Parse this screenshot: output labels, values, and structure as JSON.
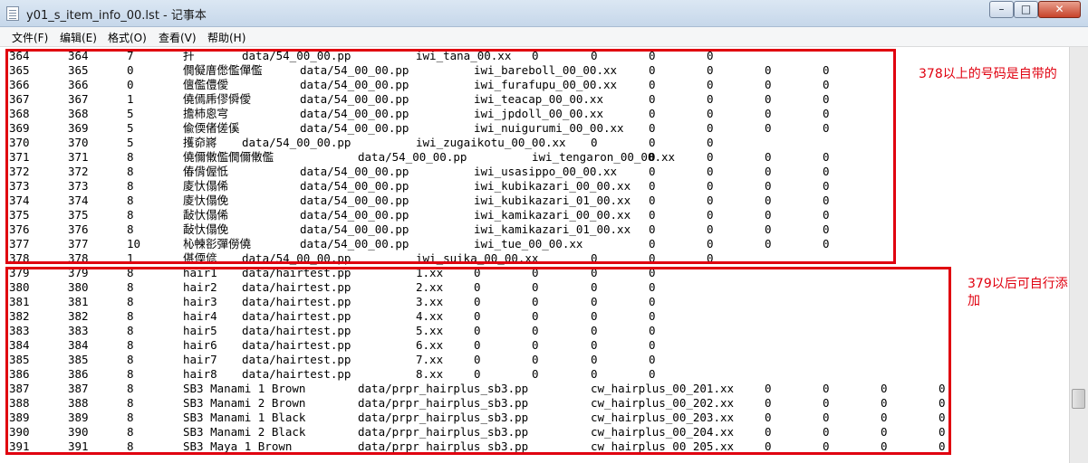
{
  "window": {
    "title": "y01_s_item_info_00.lst - 记事本",
    "minimize_glyph": "–",
    "maximize_glyph": "□",
    "close_glyph": "✕"
  },
  "menu": [
    "文件(F)",
    "编辑(E)",
    "格式(O)",
    "查看(V)",
    "帮助(H)"
  ],
  "lines": [
    [
      "364",
      "364",
      "7",
      "扞",
      "data/54_00_00.pp",
      "iwi_tana_00.xx",
      "0",
      "0",
      "0",
      "0"
    ],
    [
      "365",
      "365",
      "0",
      "僩儗庴僽儖僤儖",
      "data/54_00_00.pp",
      "iwi_bareboll_00_00.xx",
      "0",
      "0",
      "0",
      "0"
    ],
    [
      "366",
      "366",
      "0",
      "儃儖僼僾",
      "data/54_00_00.pp",
      "iwi_furafupu_00_00.xx",
      "0",
      "0",
      "0",
      "0"
    ],
    [
      "367",
      "367",
      "1",
      "僥傿乕僇僢僾",
      "data/54_00_00.pp",
      "iwi_teacap_00_00.xx",
      "0",
      "0",
      "0",
      "0"
    ],
    [
      "368",
      "368",
      "5",
      "擔杮恖宆",
      "data/54_00_00.pp",
      "iwi_jpdoll_00_00.xx",
      "0",
      "0",
      "0",
      "0"
    ],
    [
      "369",
      "369",
      "5",
      "偸偄偖傞傒",
      "data/54_00_00.pp",
      "iwi_nuigurumi_00_00.xx",
      "0",
      "0",
      "0",
      "0"
    ],
    [
      "370",
      "370",
      "5",
      "擭奅嶈",
      "data/54_00_00.pp",
      "iwi_zugaikotu_00_00.xx",
      "0",
      "0",
      "0"
    ],
    [
      "371",
      "371",
      "8",
      "僥儞僌儖僩儞僌儖",
      "data/54_00_00.pp",
      "iwi_tengaron_00_00.xx",
      "0",
      "0",
      "0",
      "0"
    ],
    [
      "372",
      "372",
      "8",
      "偆偝偓怟",
      "data/54_00_00.pp",
      "iwi_usasippo_00_00.xx",
      "0",
      "0",
      "0",
      "0"
    ],
    [
      "373",
      "373",
      "8",
      "庱忕傝俙",
      "data/54_00_00.pp",
      "iwi_kubikazari_00_00.xx",
      "0",
      "0",
      "0",
      "0"
    ],
    [
      "374",
      "374",
      "8",
      "庱忕傝俛",
      "data/54_00_00.pp",
      "iwi_kubikazari_01_00.xx",
      "0",
      "0",
      "0",
      "0"
    ],
    [
      "375",
      "375",
      "8",
      "敮忕傝俙",
      "data/54_00_00.pp",
      "iwi_kamikazari_00_00.xx",
      "0",
      "0",
      "0",
      "0"
    ],
    [
      "376",
      "376",
      "8",
      "敮忕傝俛",
      "data/54_00_00.pp",
      "iwi_kamikazari_01_00.xx",
      "0",
      "0",
      "0",
      "0"
    ],
    [
      "377",
      "377",
      "10",
      "杺朄彮彈僗僥",
      "data/54_00_00.pp",
      "iwi_tue_00_00.xx",
      "0",
      "0",
      "0",
      "0"
    ],
    [
      "378",
      "378",
      "1",
      "偡偄偐",
      "data/54_00_00.pp",
      "iwi_suika_00_00.xx",
      "0",
      "0",
      "0"
    ],
    [
      "379",
      "379",
      "8",
      "hair1",
      "data/hairtest.pp",
      "1.xx",
      "0",
      "0",
      "0",
      "0"
    ],
    [
      "380",
      "380",
      "8",
      "hair2",
      "data/hairtest.pp",
      "2.xx",
      "0",
      "0",
      "0",
      "0"
    ],
    [
      "381",
      "381",
      "8",
      "hair3",
      "data/hairtest.pp",
      "3.xx",
      "0",
      "0",
      "0",
      "0"
    ],
    [
      "382",
      "382",
      "8",
      "hair4",
      "data/hairtest.pp",
      "4.xx",
      "0",
      "0",
      "0",
      "0"
    ],
    [
      "383",
      "383",
      "8",
      "hair5",
      "data/hairtest.pp",
      "5.xx",
      "0",
      "0",
      "0",
      "0"
    ],
    [
      "384",
      "384",
      "8",
      "hair6",
      "data/hairtest.pp",
      "6.xx",
      "0",
      "0",
      "0",
      "0"
    ],
    [
      "385",
      "385",
      "8",
      "hair7",
      "data/hairtest.pp",
      "7.xx",
      "0",
      "0",
      "0",
      "0"
    ],
    [
      "386",
      "386",
      "8",
      "hair8",
      "data/hairtest.pp",
      "8.xx",
      "0",
      "0",
      "0",
      "0"
    ],
    [
      "387",
      "387",
      "8",
      "SB3 Manami 1 Brown",
      "data/prpr_hairplus_sb3.pp",
      "cw_hairplus_00_201.xx",
      "0",
      "0",
      "0",
      "0"
    ],
    [
      "388",
      "388",
      "8",
      "SB3 Manami 2 Brown",
      "data/prpr_hairplus_sb3.pp",
      "cw_hairplus_00_202.xx",
      "0",
      "0",
      "0",
      "0"
    ],
    [
      "389",
      "389",
      "8",
      "SB3 Manami 1 Black",
      "data/prpr_hairplus_sb3.pp",
      "cw_hairplus_00_203.xx",
      "0",
      "0",
      "0",
      "0"
    ],
    [
      "390",
      "390",
      "8",
      "SB3 Manami 2 Black",
      "data/prpr_hairplus_sb3.pp",
      "cw_hairplus_00_204.xx",
      "0",
      "0",
      "0",
      "0"
    ],
    [
      "391",
      "391",
      "8",
      "SB3 Maya  1 Brown",
      "data/prpr_hairplus_sb3.pp",
      "cw_hairplus_00_205.xx",
      "0",
      "0",
      "0",
      "0"
    ]
  ],
  "annotations": {
    "note_1": "378以上的号码是自带的",
    "note_2": "379以后可自行添加",
    "color": "#e0000f"
  }
}
